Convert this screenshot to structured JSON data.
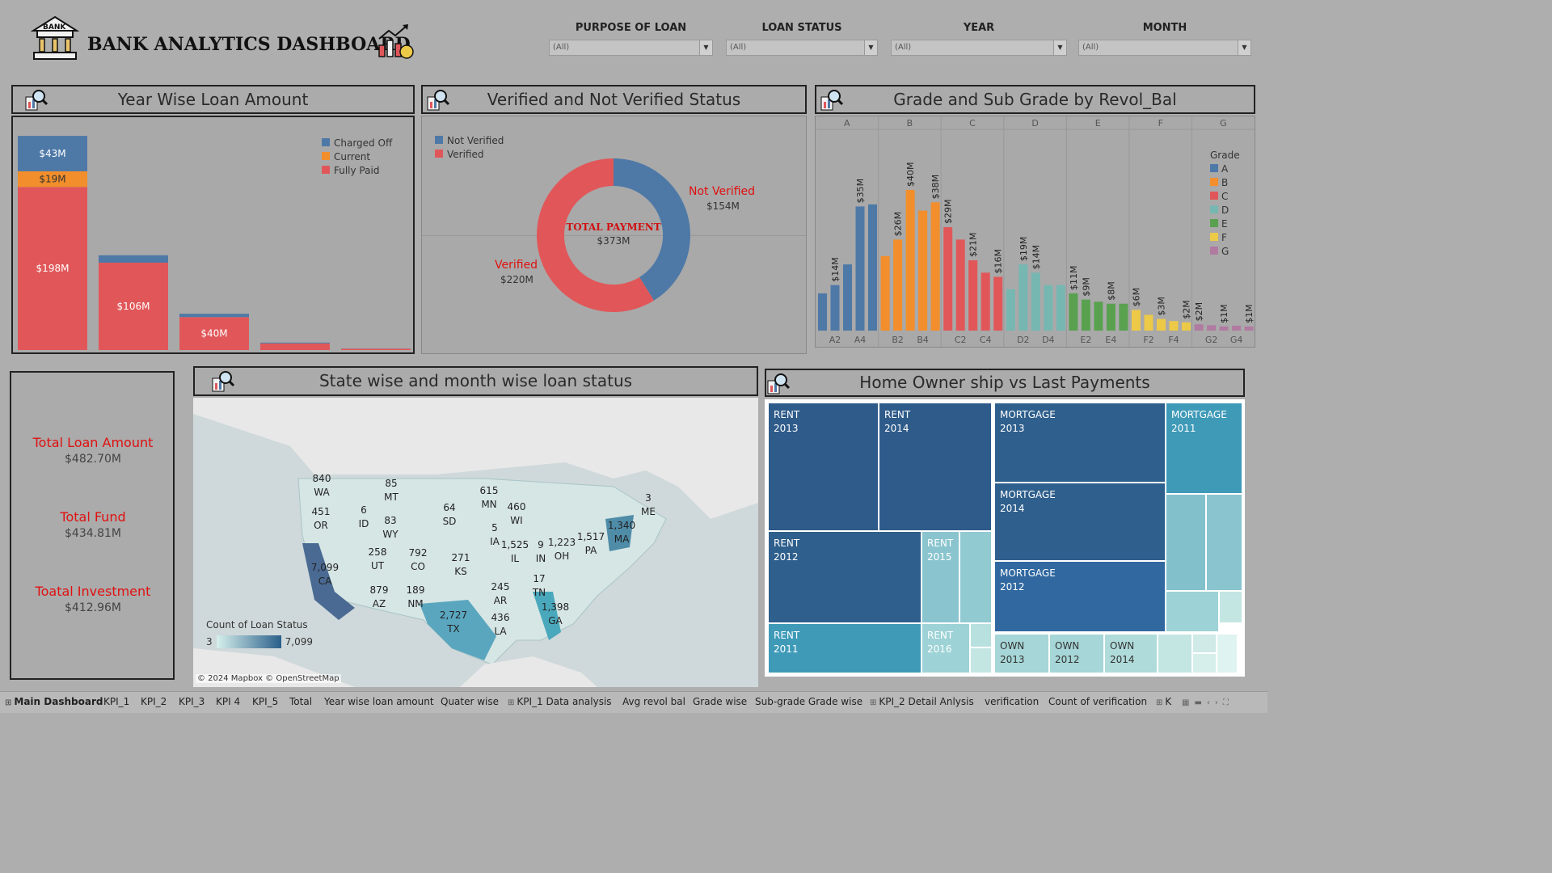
{
  "header": {
    "title": "BANK ANALYTICS DASHBOARD",
    "logo_text": "BANK"
  },
  "filters": [
    {
      "label": "PURPOSE OF LOAN",
      "value": "(All)"
    },
    {
      "label": "LOAN STATUS",
      "value": "(All)"
    },
    {
      "label": "YEAR",
      "value": "(All)"
    },
    {
      "label": "MONTH",
      "value": "(All)"
    }
  ],
  "panels": {
    "year_wise": "Year Wise Loan Amount",
    "verified": "Verified and Not Verified Status",
    "grade": "Grade and Sub Grade by Revol_Bal",
    "state": "State wise and month wise loan status",
    "home": "Home Owner ship vs Last Payments"
  },
  "colors": {
    "charged_off": "#4e79a7",
    "current": "#f28e2b",
    "fully_paid": "#e15759",
    "grade_A": "#4e79a7",
    "grade_B": "#f28e2b",
    "grade_C": "#e15759",
    "grade_D": "#76b7b2",
    "grade_E": "#59a14f",
    "grade_F": "#edc948",
    "grade_G": "#b07aa1"
  },
  "chart_data": [
    {
      "type": "bar",
      "title": "Year Wise Loan Amount",
      "stacked": true,
      "legend": "top-right",
      "series": [
        {
          "name": "Charged Off",
          "values": [
            43,
            9,
            4,
            1,
            0.2
          ]
        },
        {
          "name": "Current",
          "values": [
            19,
            0,
            0,
            0,
            0
          ]
        },
        {
          "name": "Fully Paid",
          "values": [
            198,
            106,
            40,
            8,
            1.5
          ]
        }
      ],
      "data_labels": {
        "Charged Off": [
          "$43M"
        ],
        "Current": [
          "$19M"
        ],
        "Fully Paid": [
          "$198M",
          "$106M",
          "$40M"
        ]
      },
      "ylim": [
        0,
        265
      ]
    },
    {
      "type": "pie",
      "title": "Verified and Not Verified Status",
      "donut": true,
      "center_label": "TOTAL PAYMENT",
      "center_value": "$373M",
      "legend": "top-left",
      "slices": [
        {
          "name": "Not Verified",
          "value": 154,
          "label": "$154M"
        },
        {
          "name": "Verified",
          "value": 220,
          "label": "$220M"
        }
      ]
    },
    {
      "type": "bar",
      "title": "Grade and Sub Grade by Revol_Bal",
      "legend_title": "Grade",
      "legend": "right",
      "groups": [
        "A",
        "B",
        "C",
        "D",
        "E",
        "F",
        "G"
      ],
      "x_tick_labels": [
        "A2",
        "A4",
        "B2",
        "B4",
        "C2",
        "C4",
        "D2",
        "D4",
        "E2",
        "E4",
        "F2",
        "F4",
        "G2",
        "G4"
      ],
      "bars": [
        {
          "grade": "A",
          "values": [
            9,
            11,
            16,
            30,
            30.5
          ]
        },
        {
          "grade": "B",
          "values": [
            18,
            22,
            34,
            29,
            31
          ]
        },
        {
          "grade": "C",
          "values": [
            25,
            22,
            17,
            14,
            13
          ]
        },
        {
          "grade": "D",
          "values": [
            10,
            16,
            14,
            11,
            11
          ]
        },
        {
          "grade": "E",
          "values": [
            9,
            7.5,
            7,
            6.5,
            6.5
          ]
        },
        {
          "grade": "F",
          "values": [
            5,
            3.8,
            2.8,
            2.3,
            2.0
          ]
        },
        {
          "grade": "G",
          "values": [
            1.5,
            1.3,
            1.0,
            1.2,
            1.0
          ]
        }
      ],
      "bar_labels": [
        "$14M",
        "$35M",
        "$26M",
        "$40M",
        "$38M",
        "$29M",
        "$21M",
        "$16M",
        "$19M",
        "$14M",
        "$11M",
        "$9M",
        "$8M",
        "$6M",
        "$3M",
        "$2M",
        "$2M",
        "$1M",
        "$1M"
      ],
      "ylim": [
        0,
        42
      ]
    }
  ],
  "kpis": [
    {
      "label": "Total Loan Amount",
      "value": "$482.70M"
    },
    {
      "label": "Total Fund",
      "value": "$434.81M"
    },
    {
      "label": "Toatal Investment",
      "value": "$412.96M"
    }
  ],
  "map": {
    "legend_title": "Count of Loan Status",
    "legend_min": "3",
    "legend_max": "7,099",
    "credit": "© 2024 Mapbox © OpenStreetMap",
    "states": [
      {
        "count": "840",
        "code": "WA"
      },
      {
        "count": "85",
        "code": "MT"
      },
      {
        "count": "451",
        "code": "OR"
      },
      {
        "count": "6",
        "code": "ID"
      },
      {
        "count": "83",
        "code": "WY"
      },
      {
        "count": "64",
        "code": "SD"
      },
      {
        "count": "615",
        "code": "MN"
      },
      {
        "count": "460",
        "code": "WI"
      },
      {
        "count": "3",
        "code": "ME"
      },
      {
        "count": "1,340",
        "code": "MA"
      },
      {
        "count": "5",
        "code": "IA"
      },
      {
        "count": "1,517",
        "code": "PA"
      },
      {
        "count": "1,223",
        "code": "OH"
      },
      {
        "count": "9",
        "code": "IN"
      },
      {
        "count": "1,525",
        "code": "IL"
      },
      {
        "count": "258",
        "code": "UT"
      },
      {
        "count": "792",
        "code": "CO"
      },
      {
        "count": "271",
        "code": "KS"
      },
      {
        "count": "7,099",
        "code": "CA"
      },
      {
        "count": "879",
        "code": "AZ"
      },
      {
        "count": "189",
        "code": "NM"
      },
      {
        "count": "245",
        "code": "AR"
      },
      {
        "count": "17",
        "code": "TN"
      },
      {
        "count": "1,398",
        "code": "GA"
      },
      {
        "count": "2,727",
        "code": "TX"
      },
      {
        "count": "436",
        "code": "LA"
      }
    ]
  },
  "treemap": [
    {
      "line1": "RENT",
      "line2": "2013"
    },
    {
      "line1": "RENT",
      "line2": "2014"
    },
    {
      "line1": "RENT",
      "line2": "2012"
    },
    {
      "line1": "RENT",
      "line2": "2015"
    },
    {
      "line1": "RENT",
      "line2": "2011"
    },
    {
      "line1": "RENT",
      "line2": "2016"
    },
    {
      "line1": "MORTGAGE",
      "line2": "2013"
    },
    {
      "line1": "MORTGAGE",
      "line2": "2011"
    },
    {
      "line1": "MORTGAGE",
      "line2": "2014"
    },
    {
      "line1": "MORTGAGE",
      "line2": "2012"
    },
    {
      "line1": "OWN",
      "line2": "2013"
    },
    {
      "line1": "OWN",
      "line2": "2012"
    },
    {
      "line1": "OWN",
      "line2": "2014"
    }
  ],
  "tabs": [
    "Main Dashboard",
    "KPI_1",
    "KPI_2",
    "KPI_3",
    "KPI 4",
    "KPI_5",
    "Total",
    "Year wise loan amount",
    "Quater wise",
    "KPI_1 Data analysis",
    "Avg revol bal",
    "Grade wise",
    "Sub-grade Grade wise",
    "KPI_2 Detail Anlysis",
    "verification",
    "Count of verification",
    "K"
  ]
}
